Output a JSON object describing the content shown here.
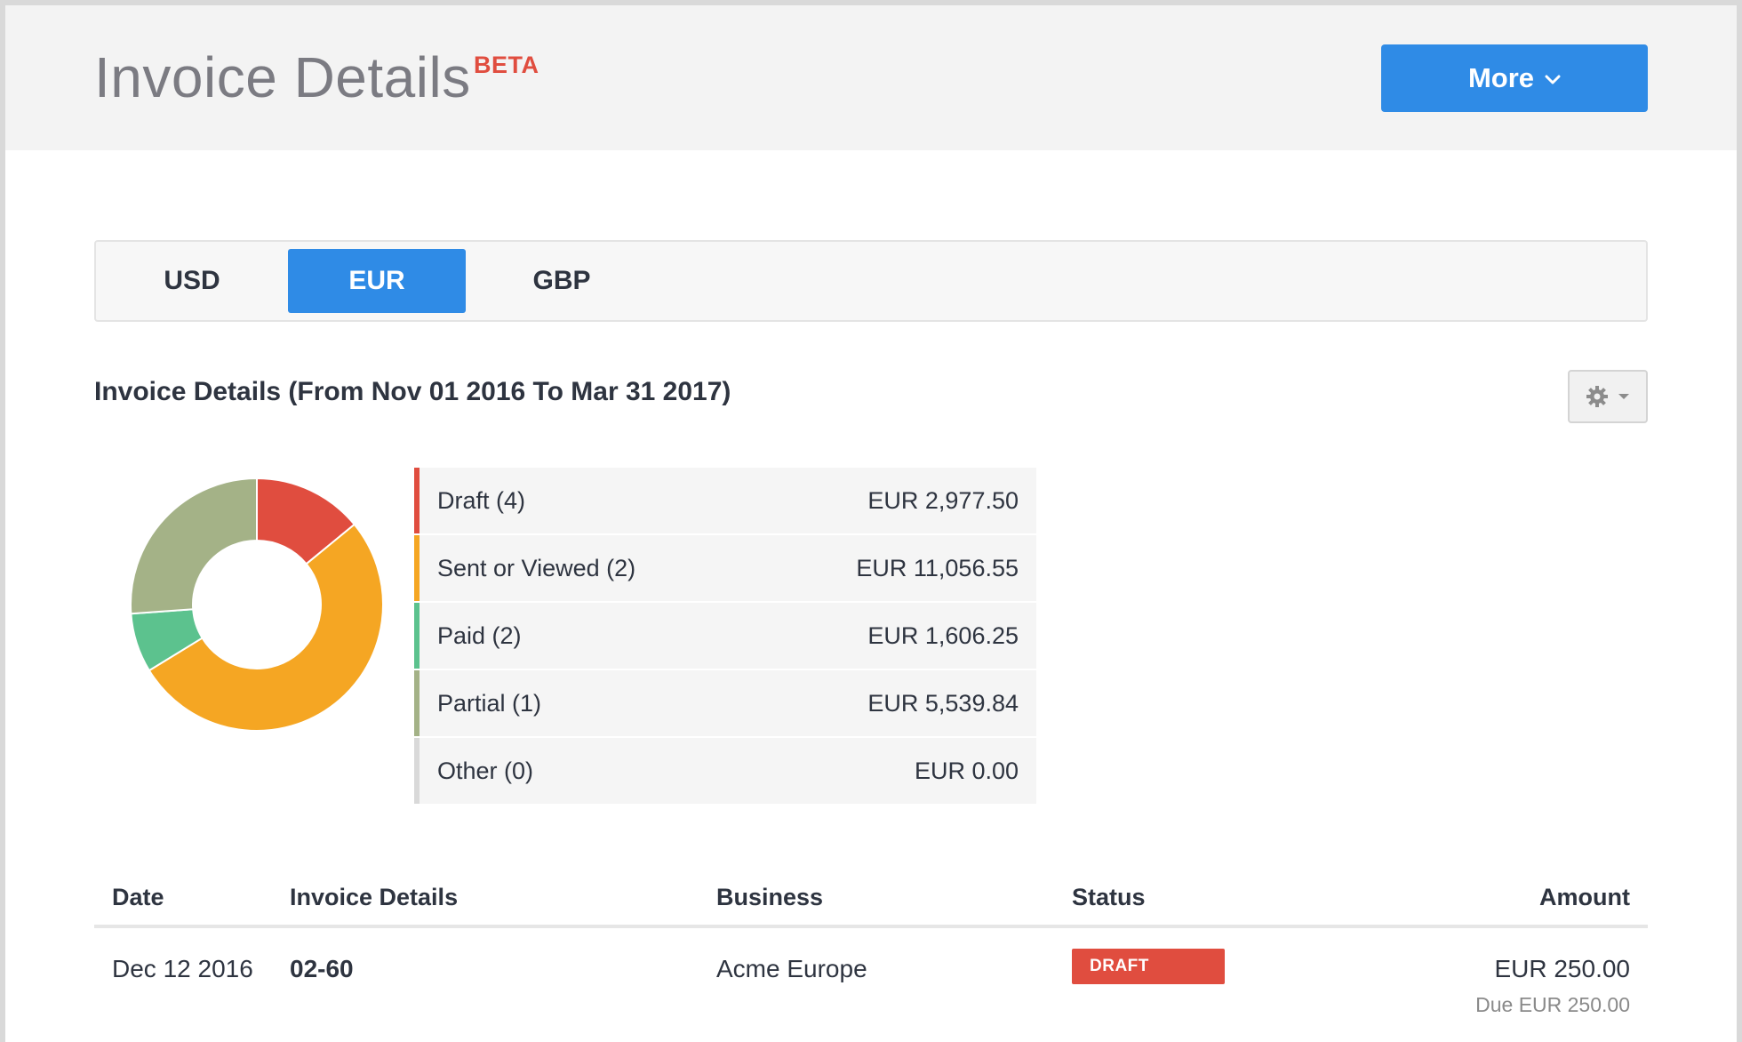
{
  "header": {
    "title": "Invoice Details",
    "badge": "BETA",
    "more_button": "More"
  },
  "currency_tabs": [
    {
      "label": "USD",
      "active": false
    },
    {
      "label": "EUR",
      "active": true
    },
    {
      "label": "GBP",
      "active": false
    }
  ],
  "section": {
    "title": "Invoice Details (From Nov 01 2016 To Mar 31 2017)",
    "settings_icon": "gear-icon"
  },
  "summary": [
    {
      "label": "Draft (4)",
      "amount": "EUR 2,977.50",
      "value": 2977.5,
      "color": "#e04d3f"
    },
    {
      "label": "Sent or Viewed (2)",
      "amount": "EUR 11,056.55",
      "value": 11056.55,
      "color": "#f5a623"
    },
    {
      "label": "Paid (2)",
      "amount": "EUR 1,606.25",
      "value": 1606.25,
      "color": "#5cc28e"
    },
    {
      "label": "Partial (1)",
      "amount": "EUR 5,539.84",
      "value": 5539.84,
      "color": "#a4b287"
    },
    {
      "label": "Other (0)",
      "amount": "EUR 0.00",
      "value": 0,
      "color": "#d9d9d9"
    }
  ],
  "table": {
    "headers": {
      "date": "Date",
      "invoice": "Invoice Details",
      "business": "Business",
      "status": "Status",
      "amount": "Amount"
    },
    "rows": [
      {
        "date": "Dec 12 2016",
        "invoice": "02-60",
        "business": "Acme Europe",
        "status": "DRAFT",
        "amount": "EUR 250.00",
        "due": "Due EUR 250.00"
      }
    ]
  },
  "colors": {
    "accent": "#2f8be6",
    "draft": "#e04d3f"
  }
}
